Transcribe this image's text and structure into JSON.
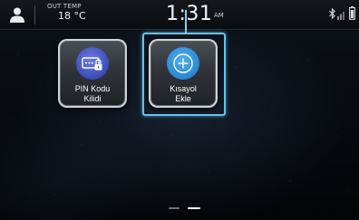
{
  "status_bar": {
    "outside_temp_label": "OUT TEMP",
    "outside_temp_value": "18 °C",
    "time": "1:31",
    "am_pm": "AM",
    "icons": [
      "user-profile-icon",
      "bluetooth-icon",
      "signal-strength-icon",
      "battery-icon"
    ]
  },
  "tiles": [
    {
      "line1": "PIN Kodu",
      "line2": "Kilidi",
      "icon": "keypad-lock-icon",
      "color": "#4a5ac8",
      "focused": false
    },
    {
      "line1": "Kısayol",
      "line2": "Ekle",
      "icon": "plus-circle-icon",
      "color": "#2f8fd9",
      "focused": true
    }
  ],
  "page_indicator": {
    "pages": 2,
    "current": 2
  },
  "colors": {
    "focus": "#64c2ee",
    "background": "#0a0d12"
  }
}
